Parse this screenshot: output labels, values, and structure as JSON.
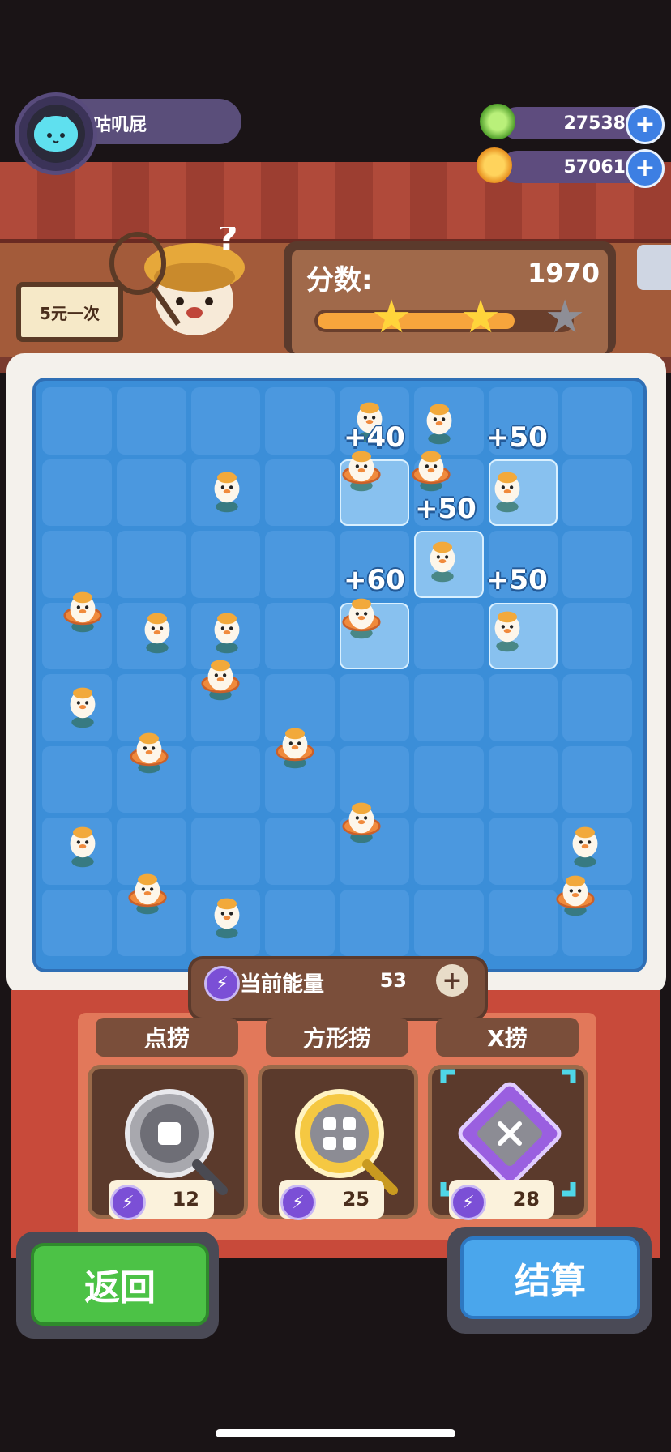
{
  "player": {
    "name": "咕叽屁",
    "avatar_icon": "cat-face-icon"
  },
  "currencies": [
    {
      "icon": "green-coin-icon",
      "value": "27538",
      "color": "#7fd64a"
    },
    {
      "icon": "gold-coin-icon",
      "value": "57061",
      "color": "#f5a623"
    }
  ],
  "shop_sign": "5元一次",
  "score": {
    "label": "分数:",
    "value": "1970",
    "progress": 0.78,
    "stars_earned": 2,
    "stars_total": 3
  },
  "board": {
    "rows": 8,
    "cols": 8,
    "bonuses": [
      "+40",
      "+50",
      "+50",
      "+60",
      "+50"
    ]
  },
  "energy": {
    "label": "当前能量",
    "value": "53"
  },
  "tools": [
    {
      "name": "点捞",
      "cost": "12",
      "icon": "dot-net-icon"
    },
    {
      "name": "方形捞",
      "cost": "25",
      "icon": "square-net-icon"
    },
    {
      "name": "X捞",
      "cost": "28",
      "icon": "x-net-icon"
    }
  ],
  "buttons": {
    "back": "返回",
    "settle": "结算"
  },
  "colors": {
    "accent_blue": "#3d7fe3",
    "water": "#3b8ed8",
    "green_button": "#4cc246",
    "blue_button": "#4aa6ec"
  }
}
